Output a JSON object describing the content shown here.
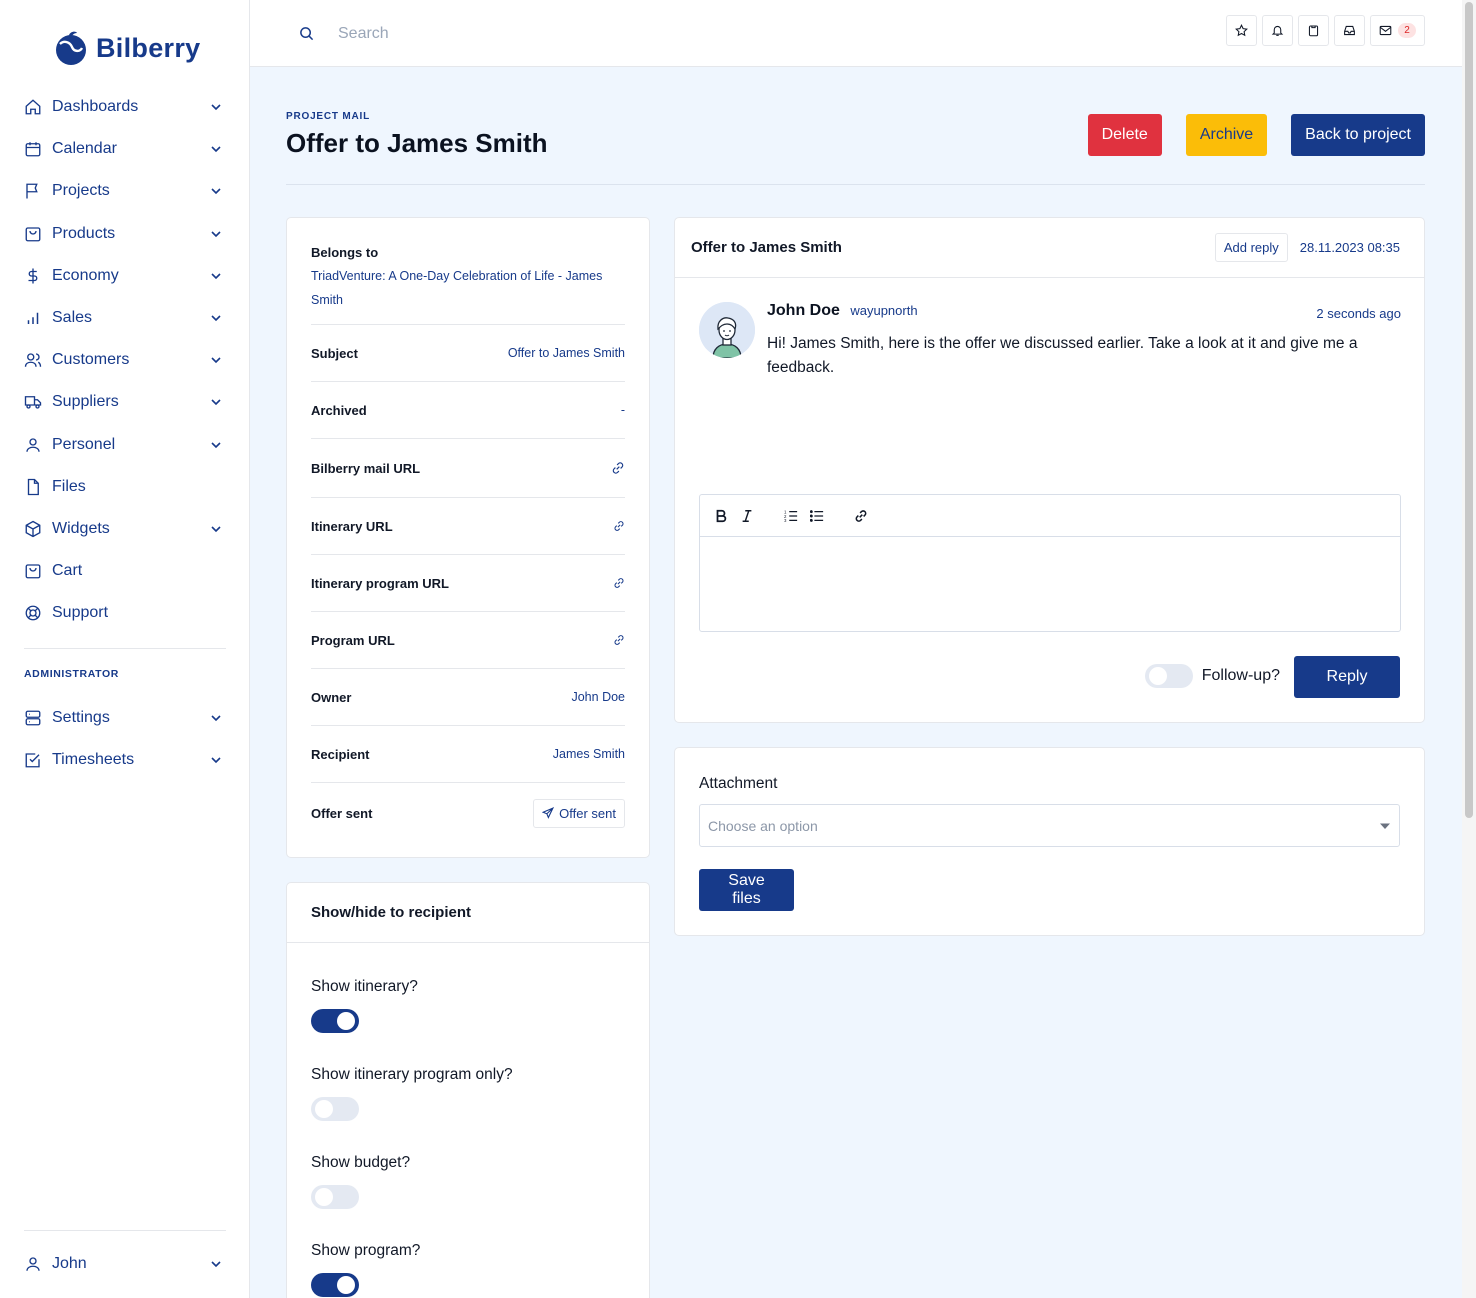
{
  "app": {
    "name": "Bilberry"
  },
  "search": {
    "placeholder": "Search"
  },
  "topbar": {
    "mail_count": "2"
  },
  "sidebar": {
    "items": [
      {
        "label": "Dashboards"
      },
      {
        "label": "Calendar"
      },
      {
        "label": "Projects"
      },
      {
        "label": "Products"
      },
      {
        "label": "Economy"
      },
      {
        "label": "Sales"
      },
      {
        "label": "Customers"
      },
      {
        "label": "Suppliers"
      },
      {
        "label": "Personel"
      },
      {
        "label": "Files"
      },
      {
        "label": "Widgets"
      },
      {
        "label": "Cart"
      },
      {
        "label": "Support"
      }
    ],
    "admin_heading": "ADMINISTRATOR",
    "admin_items": [
      {
        "label": "Settings"
      },
      {
        "label": "Timesheets"
      }
    ],
    "user": {
      "label": "John"
    }
  },
  "header": {
    "kicker": "PROJECT MAIL",
    "title": "Offer to James Smith",
    "delete_label": "Delete",
    "archive_label": "Archive",
    "back_label": "Back to project"
  },
  "info": {
    "belongs_label": "Belongs to",
    "belongs_value": "TriadVenture: A One-Day Celebration of Life - James Smith",
    "rows": [
      {
        "label": "Subject",
        "value": "Offer to James Smith"
      },
      {
        "label": "Archived",
        "value": "-"
      },
      {
        "label": "Bilberry mail URL",
        "icon": "link-icon"
      },
      {
        "label": "Itinerary URL",
        "icon": "link-icon"
      },
      {
        "label": "Itinerary program URL",
        "icon": "link-icon"
      },
      {
        "label": "Program URL",
        "icon": "link-icon"
      },
      {
        "label": "Owner",
        "value": "John Doe"
      },
      {
        "label": "Recipient",
        "value": "James Smith"
      },
      {
        "label": "Offer sent",
        "value": "Offer sent"
      }
    ]
  },
  "visibility": {
    "title": "Show/hide to recipient",
    "toggles": [
      {
        "label": "Show itinerary?",
        "on": true
      },
      {
        "label": "Show itinerary program only?",
        "on": false
      },
      {
        "label": "Show budget?",
        "on": false
      },
      {
        "label": "Show program?",
        "on": true
      }
    ]
  },
  "mail": {
    "title": "Offer to James Smith",
    "add_reply_label": "Add reply",
    "date": "28.11.2023 08:35",
    "message": {
      "author": "John Doe",
      "handle": "wayupnorth",
      "time": "2 seconds ago",
      "text": "Hi! James Smith, here is the offer we discussed earlier. Take a look at it and give me a feedback."
    },
    "follow_label": "Follow-up?",
    "follow_on": false,
    "reply_label": "Reply"
  },
  "attachment": {
    "label": "Attachment",
    "placeholder": "Choose an option",
    "save_label": "Save files"
  },
  "colors": {
    "primary": "#173a8a",
    "danger": "#e0323f",
    "warning": "#fbbd08",
    "background": "#eff6fe"
  }
}
